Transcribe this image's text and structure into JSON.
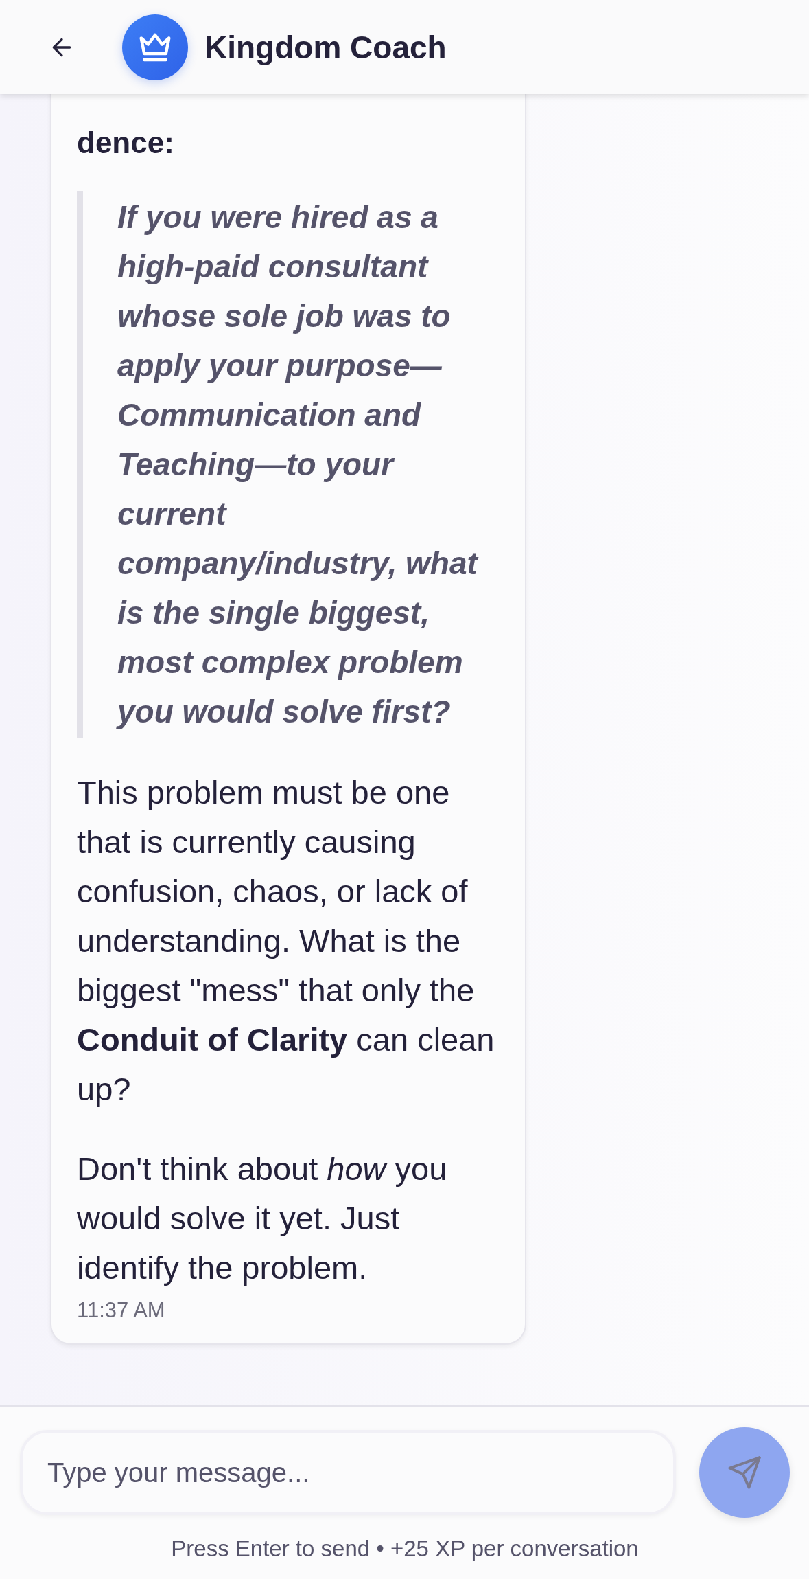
{
  "header": {
    "title": "Kingdom Coach"
  },
  "message": {
    "blocks": [
      {
        "kind": "heading",
        "text": "dence:"
      },
      {
        "kind": "quote",
        "text": "If you were hired as a high-paid consultant whose sole job was to apply your purpose—Communication and Teaching—to your current company/industry, what is the single biggest, most complex problem you would solve first?"
      },
      {
        "kind": "paragraph",
        "text": "This problem must be one that is currently causing confusion, chaos, or lack of understanding. What is the biggest \"mess\" that only the **Conduit of Clarity** can clean up?"
      },
      {
        "kind": "paragraph",
        "text": "Don't think about *how* you would solve it yet. Just identify the problem."
      }
    ],
    "time": "11:37 AM"
  },
  "composer": {
    "placeholder": "Type your message...",
    "send_disabled": true
  },
  "hint": "Press Enter to send • +25 XP per conversation"
}
